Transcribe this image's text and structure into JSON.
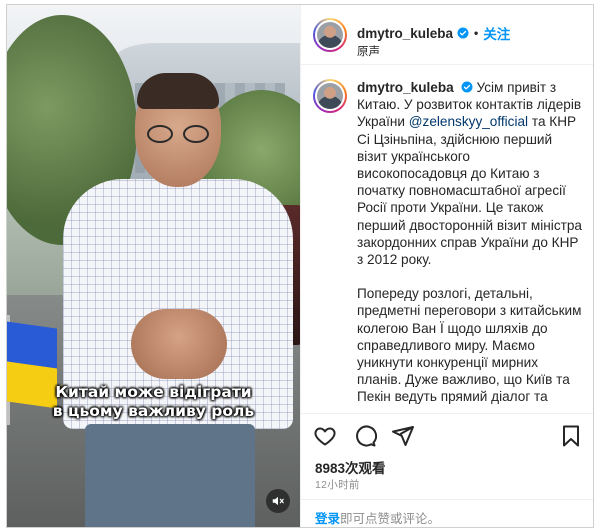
{
  "header": {
    "username": "dmytro_kuleba",
    "separator": "•",
    "follow_label": "关注",
    "audio_label": "原声"
  },
  "video": {
    "subtitle_line1": "Китай може відіграти",
    "subtitle_line2": "в цьому важливу роль",
    "mute_icon": "speaker-muted-icon"
  },
  "caption": {
    "username": "dmytro_kuleba",
    "para1_before": "Усім привіт з Китаю. У розвиток контактів лідерів України ",
    "mention": "@zelenskyy_official",
    "para1_after": " та КНР Сі Цзіньпіна, здійснюю перший візит українського високопосадовця до Китаю з початку повномасштабної агресії Росії проти України. Це також перший двосторонній візит міністра закордонних справ України до КНР з 2012 року.",
    "para2": "Попереду розлогі, детальні, предметні переговори з китайським колегою Ван Ї щодо шляхів до справедливого миру. Маємо уникнути конкуренції мирних планів. Дуже важливо, що Київ та Пекін ведуть прямий діалог та"
  },
  "actions": {
    "icons": [
      "heart-icon",
      "comment-icon",
      "share-icon",
      "bookmark-icon"
    ]
  },
  "stats": {
    "views": "8983次观看",
    "time_ago": "12小时前"
  },
  "footer": {
    "login_link": "登录",
    "login_rest": "即可点赞或评论。"
  },
  "colors": {
    "accent_blue": "#0095f6",
    "mention_blue": "#00376b",
    "text": "#262626",
    "muted": "#8e8e8e",
    "flag_blue": "#2a5bd7",
    "flag_yellow": "#f5cd12"
  }
}
